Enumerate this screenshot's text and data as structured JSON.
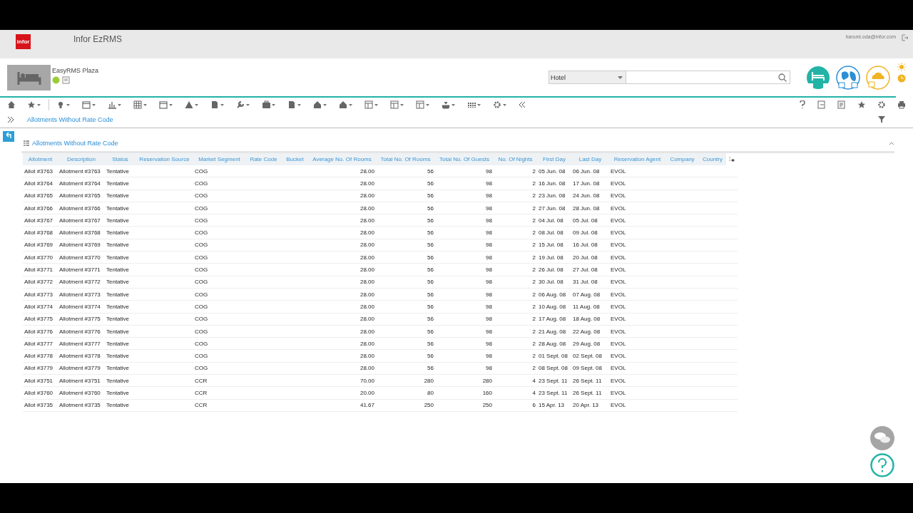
{
  "header": {
    "logo": "infor",
    "app_title": "Infor EzRMS",
    "user_email": "harumi.oda@infor.com"
  },
  "property": {
    "name": "EasyRMS Plaza"
  },
  "search": {
    "scope": "Hotel"
  },
  "breadcrumb": "Allotments Without Rate Code",
  "panel": {
    "title": "Allotments Without Rate Code"
  },
  "table": {
    "columns": [
      "Allotment",
      "Description",
      "Status",
      "Reservation Source",
      "Market Segment",
      "Rate Code",
      "Bucket",
      "Average No. Of Rooms",
      "Total No. Of Rooms",
      "Total No. Of Guests",
      "No. Of Nights",
      "First Day",
      "Last Day",
      "Reservation Agent",
      "Company",
      "Country"
    ],
    "rows": [
      {
        "allotment": "Allot #3763",
        "description": "Allotment #3763",
        "status": "Tentative",
        "market_segment": "COG",
        "avg_rooms": "28.00",
        "total_rooms": "56",
        "total_guests": "98",
        "nights": "2",
        "first_day": "05 Jun. 08",
        "last_day": "06 Jun. 08",
        "agent": "EVOL"
      },
      {
        "allotment": "Allot #3764",
        "description": "Allotment #3764",
        "status": "Tentative",
        "market_segment": "COG",
        "avg_rooms": "28.00",
        "total_rooms": "56",
        "total_guests": "98",
        "nights": "2",
        "first_day": "16 Jun. 08",
        "last_day": "17 Jun. 08",
        "agent": "EVOL"
      },
      {
        "allotment": "Allot #3765",
        "description": "Allotment #3765",
        "status": "Tentative",
        "market_segment": "COG",
        "avg_rooms": "28.00",
        "total_rooms": "56",
        "total_guests": "98",
        "nights": "2",
        "first_day": "23 Jun. 08",
        "last_day": "24 Jun. 08",
        "agent": "EVOL"
      },
      {
        "allotment": "Allot #3766",
        "description": "Allotment #3766",
        "status": "Tentative",
        "market_segment": "COG",
        "avg_rooms": "28.00",
        "total_rooms": "56",
        "total_guests": "98",
        "nights": "2",
        "first_day": "27 Jun. 08",
        "last_day": "28 Jun. 08",
        "agent": "EVOL"
      },
      {
        "allotment": "Allot #3767",
        "description": "Allotment #3767",
        "status": "Tentative",
        "market_segment": "COG",
        "avg_rooms": "28.00",
        "total_rooms": "56",
        "total_guests": "98",
        "nights": "2",
        "first_day": "04 Jul. 08",
        "last_day": "05 Jul. 08",
        "agent": "EVOL"
      },
      {
        "allotment": "Allot #3768",
        "description": "Allotment #3768",
        "status": "Tentative",
        "market_segment": "COG",
        "avg_rooms": "28.00",
        "total_rooms": "56",
        "total_guests": "98",
        "nights": "2",
        "first_day": "08 Jul. 08",
        "last_day": "09 Jul. 08",
        "agent": "EVOL"
      },
      {
        "allotment": "Allot #3769",
        "description": "Allotment #3769",
        "status": "Tentative",
        "market_segment": "COG",
        "avg_rooms": "28.00",
        "total_rooms": "56",
        "total_guests": "98",
        "nights": "2",
        "first_day": "15 Jul. 08",
        "last_day": "16 Jul. 08",
        "agent": "EVOL"
      },
      {
        "allotment": "Allot #3770",
        "description": "Allotment #3770",
        "status": "Tentative",
        "market_segment": "COG",
        "avg_rooms": "28.00",
        "total_rooms": "56",
        "total_guests": "98",
        "nights": "2",
        "first_day": "19 Jul. 08",
        "last_day": "20 Jul. 08",
        "agent": "EVOL"
      },
      {
        "allotment": "Allot #3771",
        "description": "Allotment #3771",
        "status": "Tentative",
        "market_segment": "COG",
        "avg_rooms": "28.00",
        "total_rooms": "56",
        "total_guests": "98",
        "nights": "2",
        "first_day": "26 Jul. 08",
        "last_day": "27 Jul. 08",
        "agent": "EVOL"
      },
      {
        "allotment": "Allot #3772",
        "description": "Allotment #3772",
        "status": "Tentative",
        "market_segment": "COG",
        "avg_rooms": "28.00",
        "total_rooms": "56",
        "total_guests": "98",
        "nights": "2",
        "first_day": "30 Jul. 08",
        "last_day": "31 Jul. 08",
        "agent": "EVOL"
      },
      {
        "allotment": "Allot #3773",
        "description": "Allotment #3773",
        "status": "Tentative",
        "market_segment": "COG",
        "avg_rooms": "28.00",
        "total_rooms": "56",
        "total_guests": "98",
        "nights": "2",
        "first_day": "06 Aug. 08",
        "last_day": "07 Aug. 08",
        "agent": "EVOL"
      },
      {
        "allotment": "Allot #3774",
        "description": "Allotment #3774",
        "status": "Tentative",
        "market_segment": "COG",
        "avg_rooms": "28.00",
        "total_rooms": "56",
        "total_guests": "98",
        "nights": "2",
        "first_day": "10 Aug. 08",
        "last_day": "11 Aug. 08",
        "agent": "EVOL"
      },
      {
        "allotment": "Allot #3775",
        "description": "Allotment #3775",
        "status": "Tentative",
        "market_segment": "COG",
        "avg_rooms": "28.00",
        "total_rooms": "56",
        "total_guests": "98",
        "nights": "2",
        "first_day": "17 Aug. 08",
        "last_day": "18 Aug. 08",
        "agent": "EVOL"
      },
      {
        "allotment": "Allot #3776",
        "description": "Allotment #3776",
        "status": "Tentative",
        "market_segment": "COG",
        "avg_rooms": "28.00",
        "total_rooms": "56",
        "total_guests": "98",
        "nights": "2",
        "first_day": "21 Aug. 08",
        "last_day": "22 Aug. 08",
        "agent": "EVOL"
      },
      {
        "allotment": "Allot #3777",
        "description": "Allotment #3777",
        "status": "Tentative",
        "market_segment": "COG",
        "avg_rooms": "28.00",
        "total_rooms": "56",
        "total_guests": "98",
        "nights": "2",
        "first_day": "28 Aug. 08",
        "last_day": "29 Aug. 08",
        "agent": "EVOL"
      },
      {
        "allotment": "Allot #3778",
        "description": "Allotment #3778",
        "status": "Tentative",
        "market_segment": "COG",
        "avg_rooms": "28.00",
        "total_rooms": "56",
        "total_guests": "98",
        "nights": "2",
        "first_day": "01 Sept. 08",
        "last_day": "02 Sept. 08",
        "agent": "EVOL"
      },
      {
        "allotment": "Allot #3779",
        "description": "Allotment #3779",
        "status": "Tentative",
        "market_segment": "COG",
        "avg_rooms": "28.00",
        "total_rooms": "56",
        "total_guests": "98",
        "nights": "2",
        "first_day": "08 Sept. 08",
        "last_day": "09 Sept. 08",
        "agent": "EVOL"
      },
      {
        "allotment": "Allot #3751",
        "description": "Allotment #3751",
        "status": "Tentative",
        "market_segment": "CCR",
        "avg_rooms": "70.00",
        "total_rooms": "280",
        "total_guests": "280",
        "nights": "4",
        "first_day": "23 Sept. 11",
        "last_day": "26 Sept. 11",
        "agent": "EVOL"
      },
      {
        "allotment": "Allot #3760",
        "description": "Allotment #3760",
        "status": "Tentative",
        "market_segment": "CCR",
        "avg_rooms": "20.00",
        "total_rooms": "80",
        "total_guests": "160",
        "nights": "4",
        "first_day": "23 Sept. 11",
        "last_day": "26 Sept. 11",
        "agent": "EVOL"
      },
      {
        "allotment": "Allot #3735",
        "description": "Allotment #3735",
        "status": "Tentative",
        "market_segment": "CCR",
        "avg_rooms": "41.67",
        "total_rooms": "250",
        "total_guests": "250",
        "nights": "6",
        "first_day": "15 Apr. 13",
        "last_day": "20 Apr. 13",
        "agent": "EVOL"
      }
    ]
  }
}
